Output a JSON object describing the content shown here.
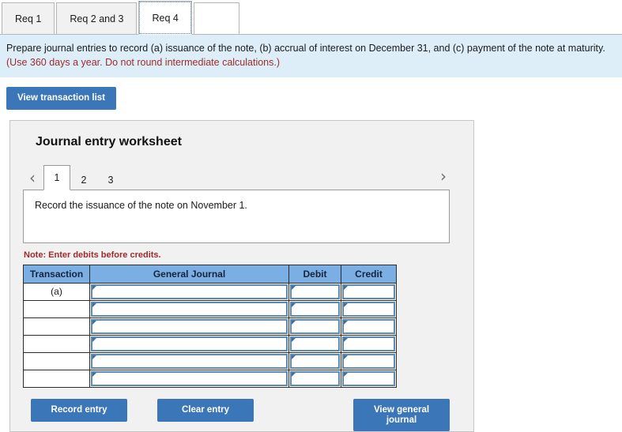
{
  "tabs": [
    {
      "label": "Req 1",
      "active": false
    },
    {
      "label": "Req 2 and 3",
      "active": false
    },
    {
      "label": "Req 4",
      "active": true
    }
  ],
  "instruction": {
    "main": "Prepare journal entries to record (a) issuance of the note, (b) accrual of interest on December 31, and (c) payment of the note at maturity.",
    "red": "(Use 360 days a year. Do not round intermediate calculations.)"
  },
  "toolbar": {
    "view_transaction_list_label": "View transaction list"
  },
  "worksheet": {
    "title": "Journal entry worksheet",
    "prev_icon": "chevron-left-icon",
    "next_icon": "chevron-right-icon",
    "prev_glyph": "‹",
    "next_glyph": "›",
    "pages": [
      {
        "label": "1",
        "active": true
      },
      {
        "label": "2",
        "active": false
      },
      {
        "label": "3",
        "active": false
      }
    ],
    "prompt": "Record the issuance of the note on November 1.",
    "note": "Note: Enter debits before credits.",
    "table": {
      "columns": [
        "Transaction",
        "General Journal",
        "Debit",
        "Credit"
      ],
      "rows": [
        {
          "transaction": "(a)",
          "general_journal": "",
          "debit": "",
          "credit": ""
        },
        {
          "transaction": "",
          "general_journal": "",
          "debit": "",
          "credit": ""
        },
        {
          "transaction": "",
          "general_journal": "",
          "debit": "",
          "credit": ""
        },
        {
          "transaction": "",
          "general_journal": "",
          "debit": "",
          "credit": ""
        },
        {
          "transaction": "",
          "general_journal": "",
          "debit": "",
          "credit": ""
        },
        {
          "transaction": "",
          "general_journal": "",
          "debit": "",
          "credit": ""
        }
      ]
    },
    "buttons": {
      "record_entry": "Record entry",
      "clear_entry": "Clear entry",
      "view_general_journal": "View general journal"
    }
  },
  "colors": {
    "button_blue": "#3b76b8",
    "table_header_blue": "#7bafe3",
    "banner_blue": "#ddeef8",
    "panel_gray": "#f1f1f1",
    "note_red": "#9e2b2b",
    "field_border_blue": "#5c88b4"
  }
}
